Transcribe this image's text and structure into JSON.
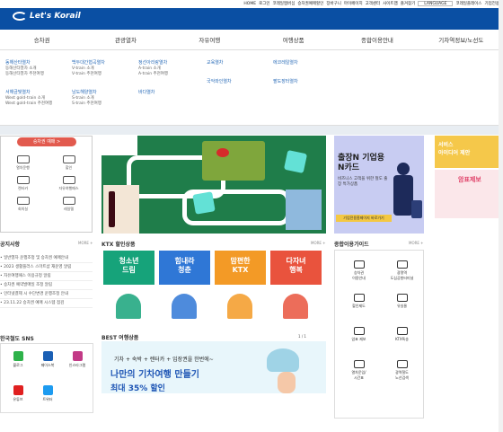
{
  "utility": [
    "HOME",
    "로그인",
    "코레일멤버십",
    "승차권예매할인",
    "장바구니",
    "마이페이지",
    "고객센터",
    "사이트맵",
    "즐겨찾기"
  ],
  "language": "LANGUAGE",
  "utility2": [
    "코레일플레이스",
    "기업전용"
  ],
  "logo": "Let's Korail",
  "gnb": [
    "승차권",
    "관광열차",
    "자유여행",
    "여행상품",
    "종합이용안내",
    "기차역정보/노선도"
  ],
  "mega": {
    "c1": [
      {
        "h": "동해산타열차",
        "items": [
          "동해산타열차 소개",
          "동해산타열차 추천여행"
        ]
      },
      {
        "h": "서해금빛열차",
        "items": [
          "West gold-train 소개",
          "West gold-train 추천여행"
        ]
      }
    ],
    "c2": [
      {
        "h": "백두대간협곡열차",
        "items": [
          "V-train 소개",
          "V-train 추천여행"
        ]
      },
      {
        "h": "남도해양열차",
        "items": [
          "S-train 소개",
          "S-train 추천여행"
        ]
      }
    ],
    "c3": [
      {
        "h": "정선아리랑열차",
        "items": [
          "A-train 소개",
          "A-train 추천여행"
        ]
      },
      {
        "h": "바다열차",
        "items": []
      }
    ],
    "c4": [
      {
        "h": "교육열차",
        "items": []
      },
      {
        "h": "국악와인열차",
        "items": []
      }
    ],
    "c5": [
      {
        "h": "에코레일열차",
        "items": []
      },
      {
        "h": "팔도장터열차",
        "items": []
      }
    ]
  },
  "reserve_btn": "승차권 예매 >",
  "quick": [
    "열차운행",
    "할인",
    "렌터카",
    "자유여행패스",
    "회의실",
    "레일텔"
  ],
  "right_banner": {
    "title": "출장N 기업용 N카드",
    "sub": "비즈니스 고객을 위한 철도 출장 특가상품",
    "btn": "기업전용홈페이지 바로가기"
  },
  "far_banner": {
    "t1": "서비스",
    "t2": "아이디어 제안",
    "t3": "암표제보"
  },
  "notice": {
    "title": "공지사항",
    "more": "MORE +",
    "items": [
      "일반열차 운행조정 및 승차권 예매안내",
      "2023 생활플러스 스마트샵 재운영 알림",
      "자유여행패스 이용규정 알림",
      "승차권 예약발매일 조정 알림",
      "인터넷결제 시 수단변경 운행조정 안내",
      "23.11.22 승차권 예매 시스템 점검"
    ]
  },
  "sns": {
    "title": "한국철도 SNS",
    "items": [
      "블로그",
      "페이스북",
      "인스타그램",
      "유튜브",
      "트위터"
    ],
    "colors": [
      "#2eb24a",
      "#1a5fb4",
      "#c23a86",
      "#e02020",
      "#1d9bf0"
    ]
  },
  "ktx": {
    "title": "KTX 할인상품",
    "more": "MORE +",
    "cards": [
      {
        "t": "청소년\n드림",
        "c": "#16a37a"
      },
      {
        "t": "힘내라\n청춘",
        "c": "#2f77d6"
      },
      {
        "t": "맘편한\nKTX",
        "c": "#f39a26"
      },
      {
        "t": "다자녀\n행복",
        "c": "#e9533d"
      }
    ]
  },
  "guide": {
    "title": "종합이용가이드",
    "more": "MORE +",
    "items": [
      "승차권\n이용안내",
      "광명역\n도심공항터미널",
      "할인제도",
      "유실물",
      "암표 제보",
      "KTX특송",
      "열차운임/\n시간표",
      "광역철도\n노선검색"
    ]
  },
  "best": {
    "title": "BEST 여행상품",
    "page": "1 / 1"
  },
  "trip": {
    "sub": "기차 + 숙박 + 렌터카 + 입장권을 한번에~",
    "main": "나만의 기차여행 만들기",
    "disc": "최대 35% 할인"
  }
}
